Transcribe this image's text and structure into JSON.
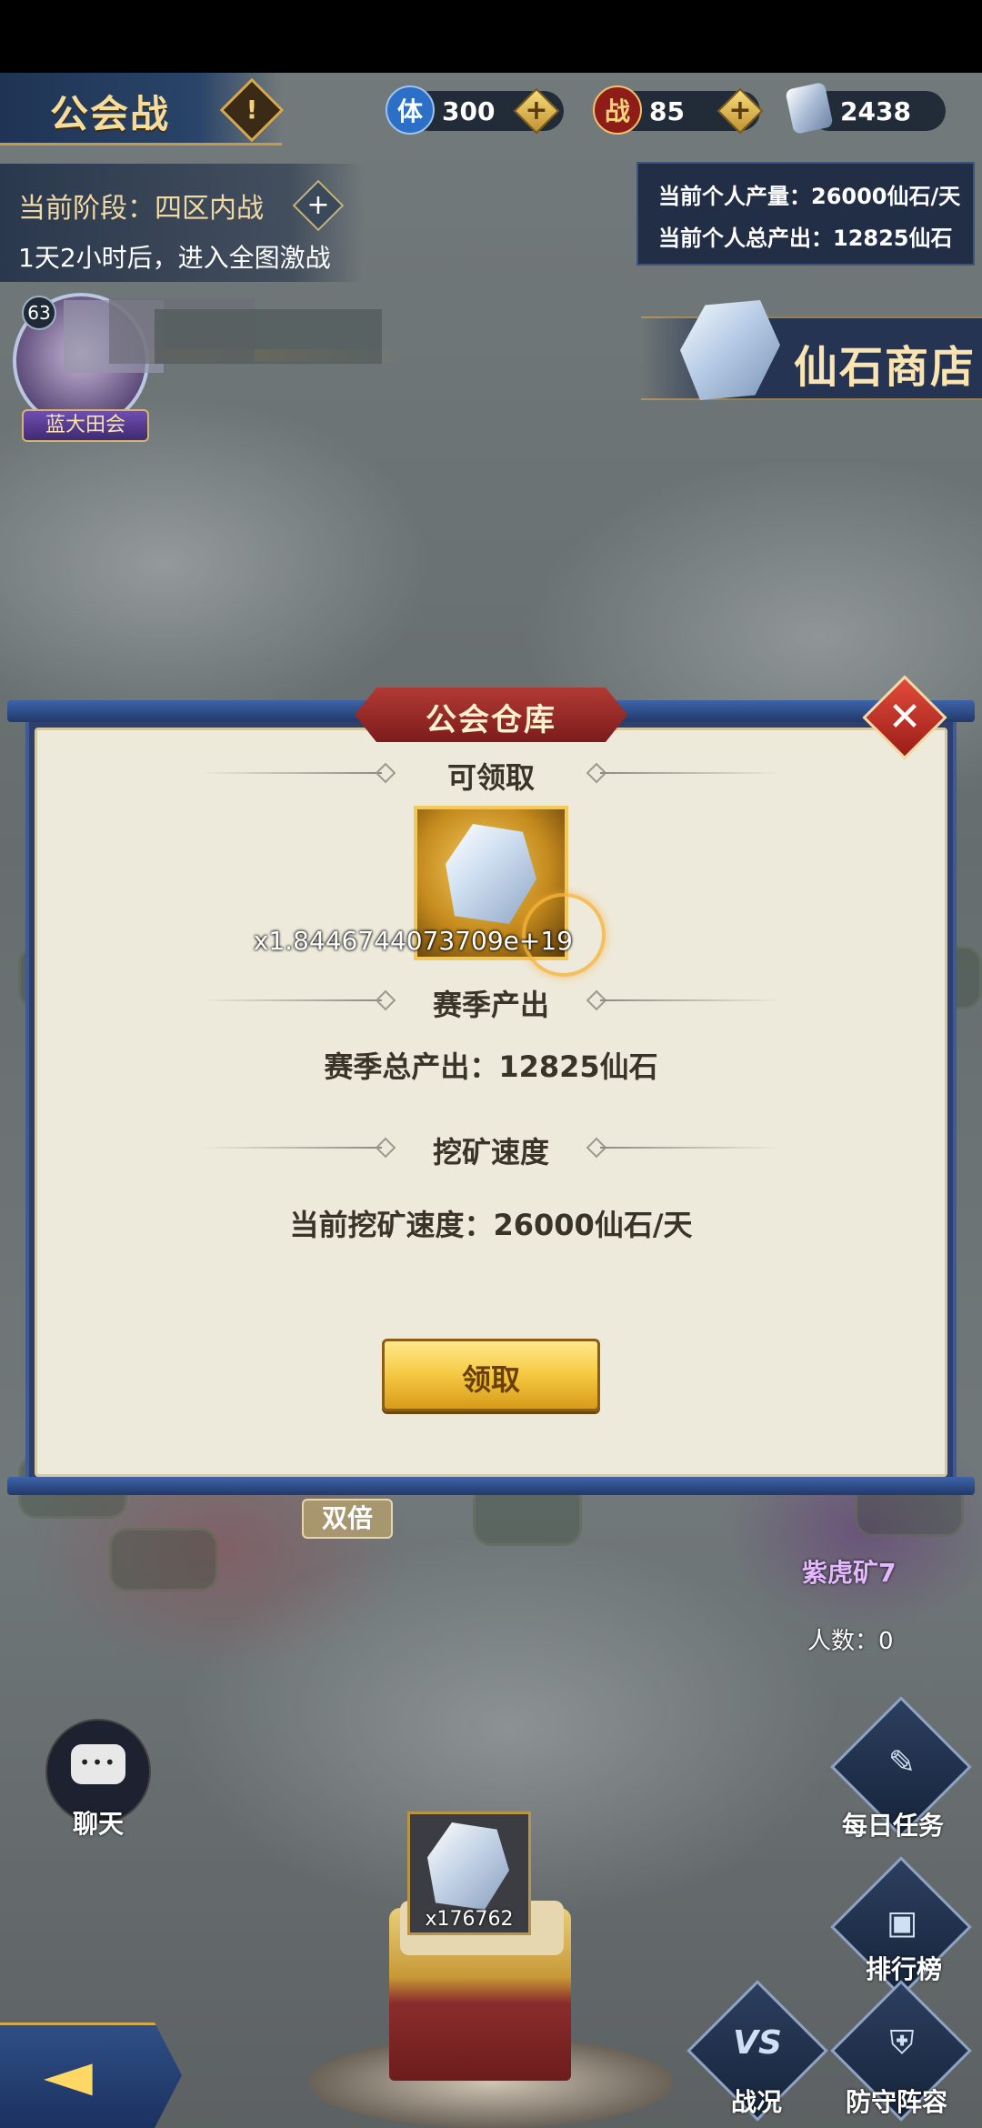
{
  "header": {
    "title": "公会战",
    "warn_glyph": "!",
    "resources": [
      {
        "icon": "stamina-icon",
        "glyph": "体",
        "value": "300",
        "color": "#2c6fc7"
      },
      {
        "icon": "battle-token-icon",
        "glyph": "战",
        "value": "85",
        "color": "#b3261e"
      },
      {
        "icon": "spirit-stone-icon",
        "glyph": "",
        "value": "2438",
        "color": "#a9bcd6"
      }
    ],
    "plus_glyph": "+"
  },
  "phase": {
    "current": "当前阶段：四区内战",
    "countdown": "1天2小时后，进入全图激战",
    "plus_glyph": "+"
  },
  "production": {
    "personal_rate": "当前个人产量：26000仙石/天",
    "personal_total": "当前个人总产出：12825仙石"
  },
  "player": {
    "level": "63",
    "tag": "蓝大田会"
  },
  "shop": {
    "label": "仙石商店"
  },
  "dialog": {
    "title": "公会仓库",
    "close_glyph": "✕",
    "section_claimable": "可领取",
    "item_count": "x1.8446744073709e+19",
    "section_season": "赛季产出",
    "season_total": "赛季总产出：12825仙石",
    "section_speed": "挖矿速度",
    "speed_text": "当前挖矿速度：26000仙石/天",
    "claim_button": "领取"
  },
  "map": {
    "double_tag": "双倍",
    "mine_name": "紫虎矿7",
    "mine_count": "人数：0"
  },
  "bottom": {
    "chat_label": "聊天",
    "chat_dots": "•••",
    "daily_tasks": "每日任务",
    "ranking": "排行榜",
    "war_status": "战况",
    "war_status_glyph": "VS",
    "defense_lineup": "防守阵容",
    "back_glyph": "◄",
    "chest_item_count": "x176762"
  }
}
